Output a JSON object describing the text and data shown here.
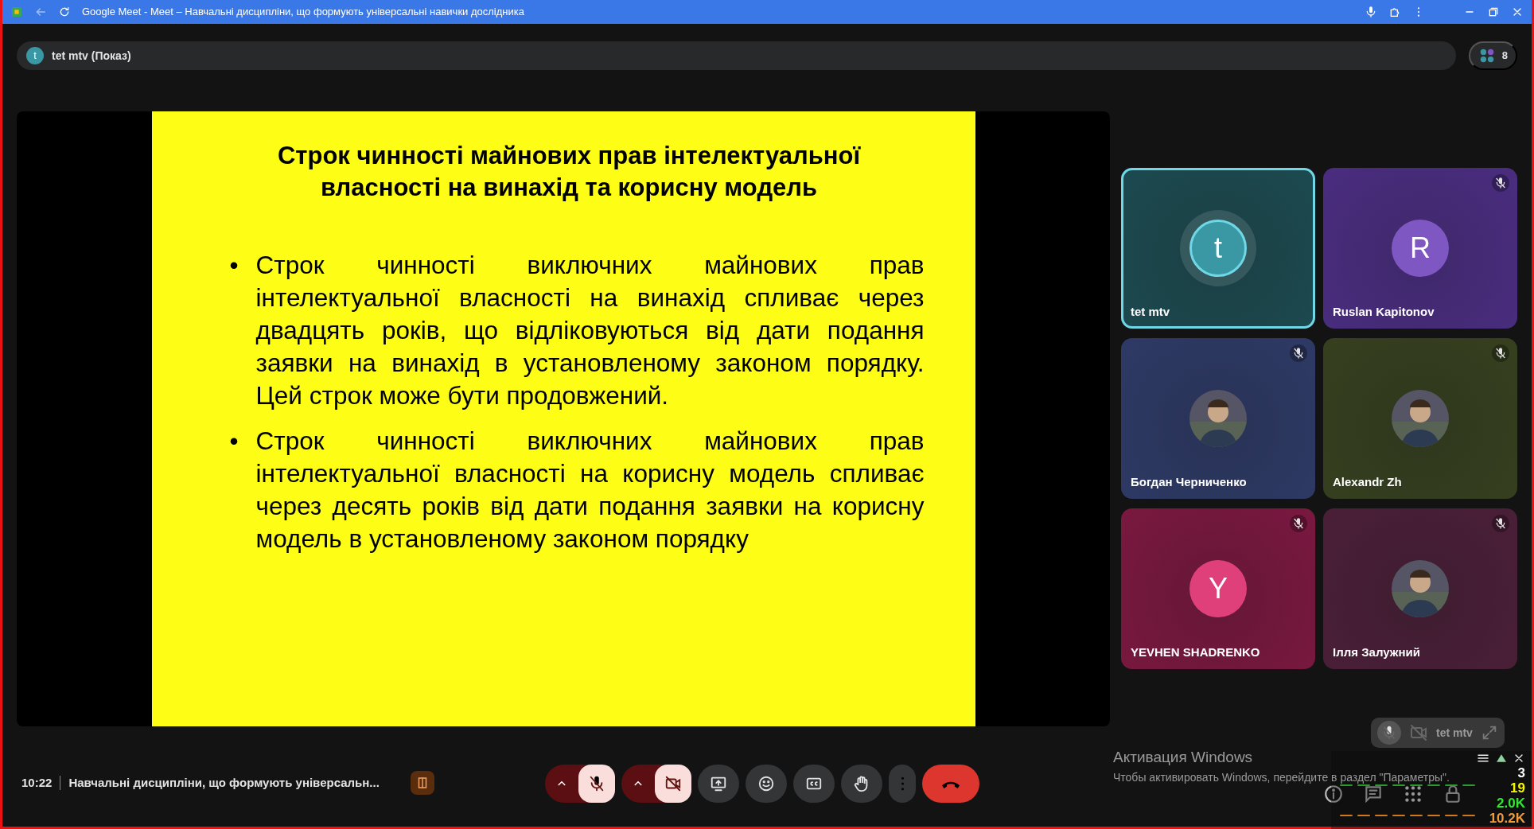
{
  "browser": {
    "title": "Google Meet - Meet – Навчальні дисципліни, що формують універсальні навички дослідника"
  },
  "presenter_bar": {
    "initial": "t",
    "label": "tet mtv (Показ)",
    "participant_count": "8"
  },
  "slide": {
    "title": "Строк чинності майнових прав інтелектуальної власності на винахід та корисну модель",
    "bullets": [
      {
        "bullet": "•",
        "text": "Строк чинності виключних майнових прав інтелектуальної власності на винахід спливає через двадцять років, що відліковуються від дати подання заявки на винахід в установленому законом порядку. Цей строк може бути продовжений."
      },
      {
        "bullet": "•",
        "text": "Строк чинності виключних майнових прав інтелектуальної власності на корисну модель спливає через десять років від дати подання заявки на корисну модель в установленому законом порядку"
      }
    ]
  },
  "tiles": [
    {
      "kind": "letter",
      "name": "tet mtv",
      "initial": "t",
      "speaking": true,
      "muted": false,
      "color": "#1c4a50",
      "avatar": {
        "color": "#3a98a4"
      }
    },
    {
      "kind": "letter",
      "name": "Ruslan Kapitonov",
      "initial": "R",
      "speaking": false,
      "muted": true,
      "color": "#4a2d80",
      "avatar": {
        "color": "#7e57c2"
      }
    },
    {
      "name": "Богдан Черниченко",
      "speaking": false,
      "muted": true,
      "color": "#2e3a66"
    },
    {
      "name": "Alexandr Zh",
      "speaking": false,
      "muted": true,
      "color": "#36401f"
    },
    {
      "kind": "letter",
      "name": "YEVHEN SHADRENKO",
      "initial": "Y",
      "speaking": false,
      "muted": true,
      "color": "#7a1840",
      "avatar": {
        "color": "#e0407a"
      }
    },
    {
      "name": "Ілля Залужний",
      "speaking": false,
      "muted": true,
      "color": "#4a1f38"
    }
  ],
  "self_view": {
    "name": "tet mtv"
  },
  "windows_activation": {
    "title": "Активация Windows",
    "text": "Чтобы активировать Windows, перейдите в раздел \"Параметры\"."
  },
  "stats_overlay": {
    "values": [
      {
        "text": "3",
        "color": "#ffffff"
      },
      {
        "text": "19",
        "color": "#f5f500"
      },
      {
        "text": "2.0K",
        "color": "#33e633"
      },
      {
        "text": "10.2K",
        "color": "#f09a3a"
      }
    ]
  },
  "meeting": {
    "time": "10:22",
    "title": "Навчальні дисципліни, що формують універсальн..."
  },
  "controls": {
    "mic_on": false,
    "camera_on": false
  }
}
